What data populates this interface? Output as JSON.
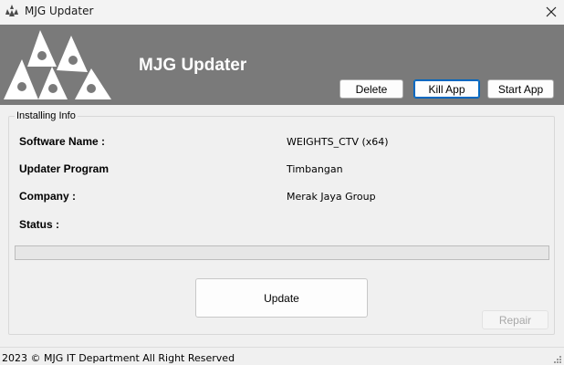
{
  "window": {
    "title": "MJG Updater",
    "icon": "mjg-logo-icon",
    "close_icon": "close-icon"
  },
  "header": {
    "app_name": "MJG Updater",
    "logo": "mjg-logo",
    "background": "#7a7a7a",
    "buttons": {
      "delete": "Delete",
      "kill_app": "Kill App",
      "start_app": "Start App"
    }
  },
  "install_info": {
    "legend": "Installing Info",
    "software_name_label": "Software Name :",
    "software_name_value": "WEIGHTS_CTV (x64)",
    "updater_program_label": "Updater Program",
    "updater_program_value": "Timbangan",
    "company_label": "Company :",
    "company_value": "Merak Jaya Group",
    "status_label": "Status :",
    "status_value": "",
    "progress": 0
  },
  "actions": {
    "update": "Update",
    "repair": "Repair"
  },
  "footer": {
    "copyright": "2023 © MJG IT Department All Right Reserved"
  }
}
